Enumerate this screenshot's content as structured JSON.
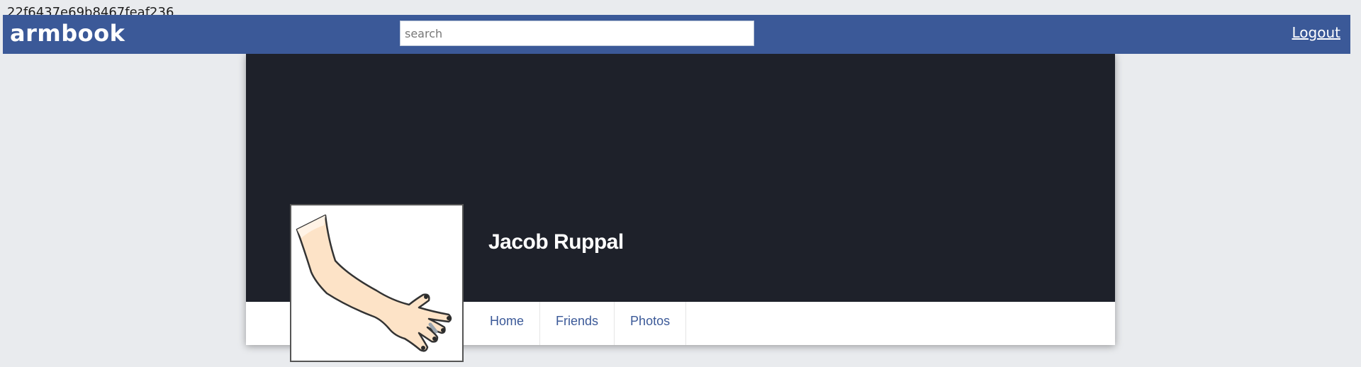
{
  "page": {
    "hash_text": "22f6437e69b8467feaf236"
  },
  "topbar": {
    "brand": "armbook",
    "search_placeholder": "search",
    "search_value": "",
    "logout_label": "Logout",
    "background_color": "#3b5998"
  },
  "profile": {
    "name": "Jacob Ruppal",
    "cover_color": "#1e212a",
    "avatar_icon": "arm-drawing-icon"
  },
  "nav": {
    "items": [
      {
        "label": "Home"
      },
      {
        "label": "Friends"
      },
      {
        "label": "Photos"
      }
    ]
  }
}
